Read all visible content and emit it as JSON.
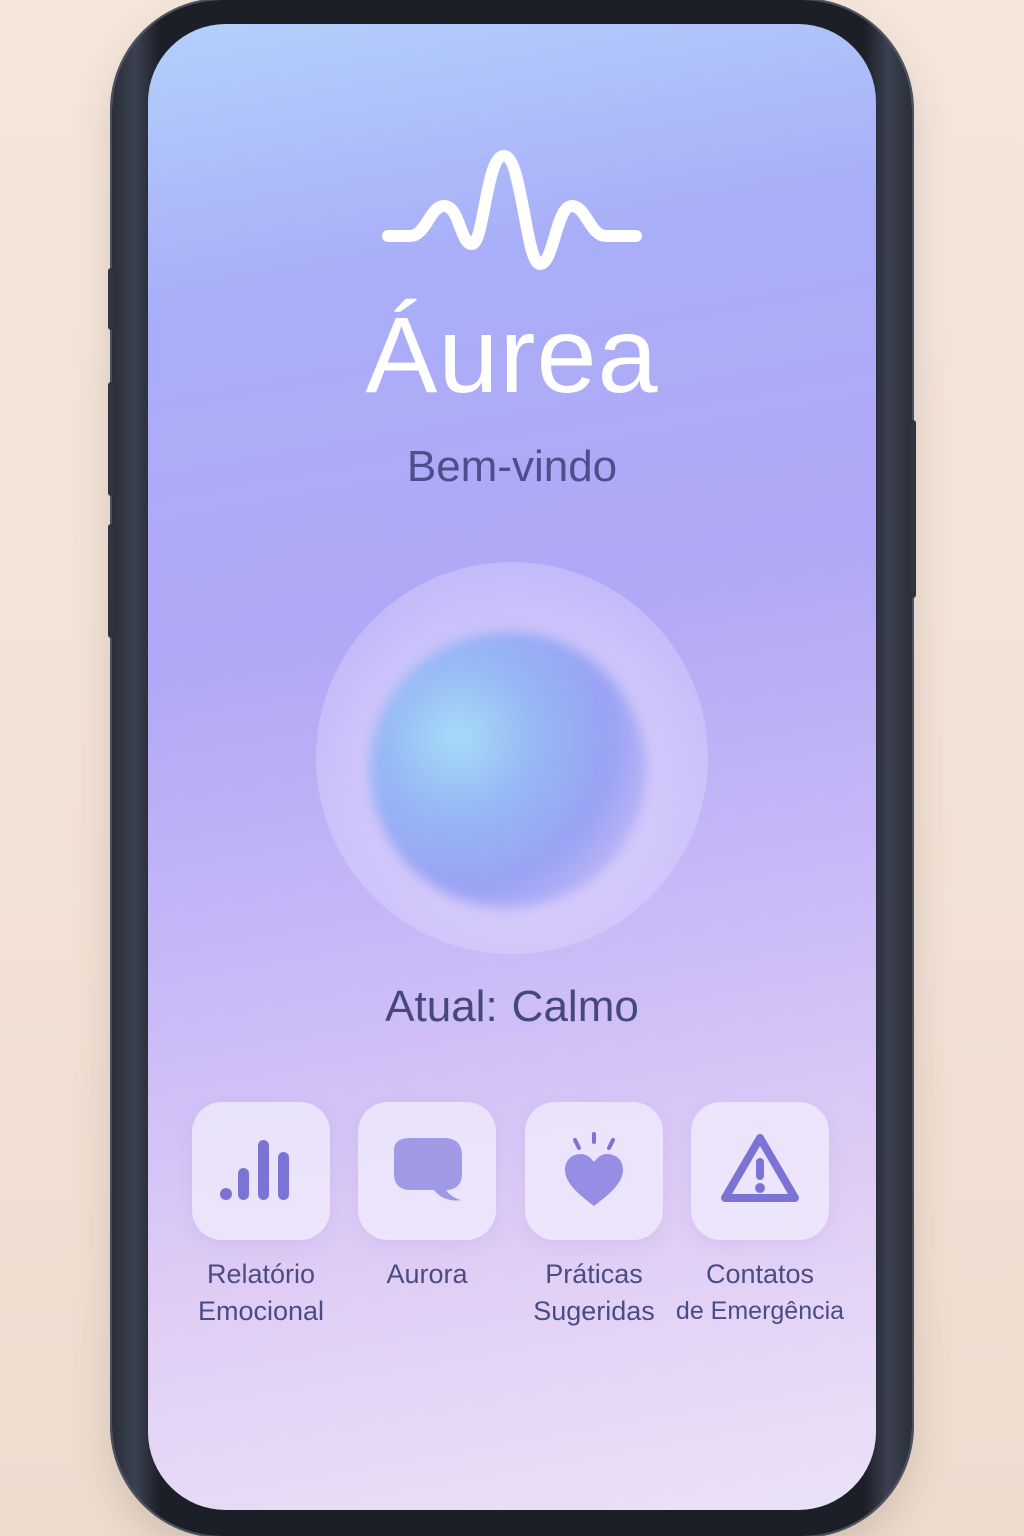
{
  "app": {
    "title": "Áurea",
    "welcome": "Bem-vindo"
  },
  "status": {
    "label": "Atual:",
    "value": "Calmo"
  },
  "actions": [
    {
      "id": "relatorio",
      "icon": "bar-chart-icon",
      "line1": "Relatório",
      "line2": "Emocional"
    },
    {
      "id": "aurora",
      "icon": "chat-bubble-icon",
      "line1": "Aurora",
      "line2": ""
    },
    {
      "id": "praticas",
      "icon": "heart-sparkle-icon",
      "line1": "Práticas",
      "line2": "Sugeridas"
    },
    {
      "id": "contatos",
      "icon": "warning-triangle-icon",
      "line1": "Contatos",
      "line2": "de Emergência"
    }
  ],
  "colors": {
    "accent": "#7c74d4",
    "text": "#4a4c86",
    "title": "#ffffff"
  }
}
